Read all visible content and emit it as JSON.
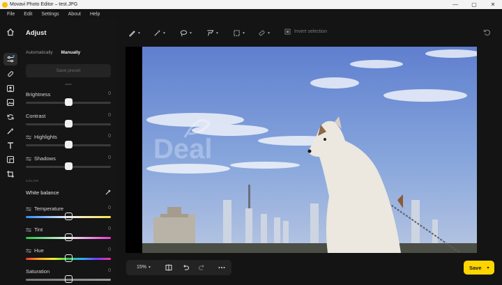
{
  "window": {
    "title": "Movavi Photo Editor – test.JPG",
    "controls": [
      "—",
      "▢",
      "✕"
    ]
  },
  "menu": [
    "File",
    "Edit",
    "Settings",
    "About",
    "Help"
  ],
  "sidebar_icons": [
    "home-icon",
    "adjust-icon",
    "retouch-icon",
    "portrait-icon",
    "image-icon",
    "replace-icon",
    "effects-icon",
    "text-icon",
    "crop-frame-icon",
    "crop-icon"
  ],
  "panel": {
    "title": "Adjust",
    "mode_auto": "Automatically",
    "mode_manual": "Manually",
    "save_preset": "Save preset",
    "section_color": "COLOR",
    "white_balance": "White balance"
  },
  "sliders": [
    {
      "label": "Brightness",
      "value": "0",
      "level": 0.5
    },
    {
      "label": "Contrast",
      "value": "0",
      "level": 0.5
    },
    {
      "label": "Highlights",
      "value": "0",
      "level": 0.5
    },
    {
      "label": "Shadows",
      "value": "0",
      "level": 0.5
    }
  ],
  "color_sliders": [
    {
      "label": "Temperature",
      "value": "0",
      "level": 0.5
    },
    {
      "label": "Tint",
      "value": "0",
      "level": 0.5
    },
    {
      "label": "Hue",
      "value": "0",
      "level": 0.5
    },
    {
      "label": "Saturation",
      "value": "0",
      "level": 0.5
    }
  ],
  "toolbar": {
    "tools": [
      "brush-icon",
      "magic-wand-icon",
      "lasso-icon",
      "polygon-lasso-icon",
      "rectangle-select-icon",
      "eraser-icon"
    ],
    "invert_selection": "Invert selection"
  },
  "bottom": {
    "zoom": "15%"
  },
  "save": {
    "label": "Save"
  },
  "colors": {
    "accent": "#ffd500",
    "background": "#141414"
  }
}
